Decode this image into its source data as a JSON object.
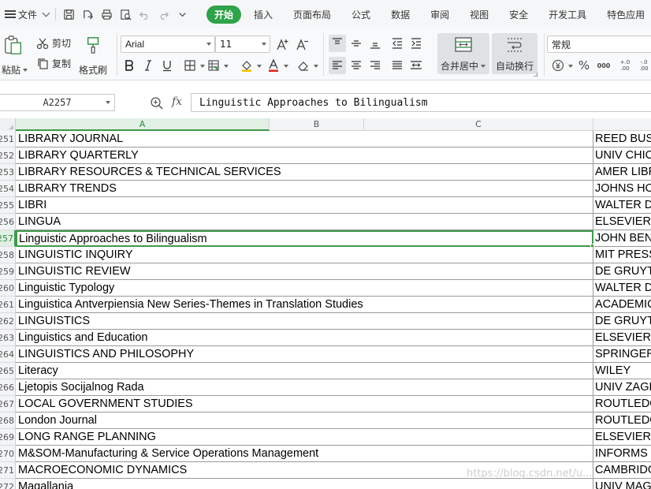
{
  "menubar": {
    "file_label": "文件",
    "tabs": [
      {
        "label": "开始",
        "active": true
      },
      {
        "label": "插入"
      },
      {
        "label": "页面布局"
      },
      {
        "label": "公式"
      },
      {
        "label": "数据"
      },
      {
        "label": "审阅"
      },
      {
        "label": "视图"
      },
      {
        "label": "安全"
      },
      {
        "label": "开发工具"
      },
      {
        "label": "特色应用"
      }
    ]
  },
  "ribbon": {
    "paste_label": "粘贴",
    "cut_label": "剪切",
    "copy_label": "复制",
    "format_painter_label": "格式刷",
    "font_name": "Arial",
    "font_size": "11",
    "merge_center_label": "合并居中",
    "wrap_text_label": "自动换行",
    "number_format": "常规",
    "percent_symbol": "%",
    "thousands_symbol": "000",
    "inc_decimal": "+.0\n.00",
    "dec_decimal": "-.0\n.00"
  },
  "formula_bar": {
    "name_box": "A2257",
    "fx_label": "fx",
    "formula": "Linguistic Approaches to Bilingualism"
  },
  "columns": [
    "A",
    "B",
    "C"
  ],
  "rows": [
    {
      "num": "2251",
      "a": "LIBRARY JOURNAL",
      "d": "REED BUSINESS"
    },
    {
      "num": "2252",
      "a": "LIBRARY QUARTERLY",
      "d": "UNIV CHICAGO"
    },
    {
      "num": "2253",
      "a": "LIBRARY RESOURCES & TECHNICAL SERVICES",
      "d": "AMER LIBRARY"
    },
    {
      "num": "2254",
      "a": "LIBRARY TRENDS",
      "d": "JOHNS HOPKINS"
    },
    {
      "num": "2255",
      "a": "LIBRI",
      "d": "WALTER DE"
    },
    {
      "num": "2256",
      "a": "LINGUA",
      "d": "ELSEVIER"
    },
    {
      "num": "2257",
      "a": "Linguistic Approaches to Bilingualism",
      "d": "JOHN BENJAMINS",
      "selected": true
    },
    {
      "num": "2258",
      "a": "LINGUISTIC INQUIRY",
      "d": "MIT PRESS"
    },
    {
      "num": "2259",
      "a": "LINGUISTIC REVIEW",
      "d": "DE GRUYTER"
    },
    {
      "num": "2260",
      "a": "Linguistic Typology",
      "d": "WALTER DE"
    },
    {
      "num": "2261",
      "a": "Linguistica Antverpiensia New Series-Themes in Translation Studies",
      "d": "ACADEMIC"
    },
    {
      "num": "2262",
      "a": "LINGUISTICS",
      "d": "DE GRUYTER"
    },
    {
      "num": "2263",
      "a": "Linguistics and Education",
      "d": "ELSEVIER"
    },
    {
      "num": "2264",
      "a": "LINGUISTICS AND PHILOSOPHY",
      "d": "SPRINGER"
    },
    {
      "num": "2265",
      "a": "Literacy",
      "d": "WILEY"
    },
    {
      "num": "2266",
      "a": "Ljetopis Socijalnog Rada",
      "d": "UNIV ZAGREB"
    },
    {
      "num": "2267",
      "a": "LOCAL GOVERNMENT STUDIES",
      "d": "ROUTLEDGE"
    },
    {
      "num": "2268",
      "a": "London Journal",
      "d": "ROUTLEDGE"
    },
    {
      "num": "2269",
      "a": "LONG RANGE PLANNING",
      "d": "ELSEVIER"
    },
    {
      "num": "2270",
      "a": "M&SOM-Manufacturing & Service Operations Management",
      "d": "INFORMS"
    },
    {
      "num": "2271",
      "a": "MACROECONOMIC DYNAMICS",
      "d": "CAMBRIDGE"
    },
    {
      "num": "2272",
      "a": "Magallania",
      "d": "UNIV MAGALLANES"
    }
  ],
  "watermark": "https://blog.csdn.net/u..."
}
